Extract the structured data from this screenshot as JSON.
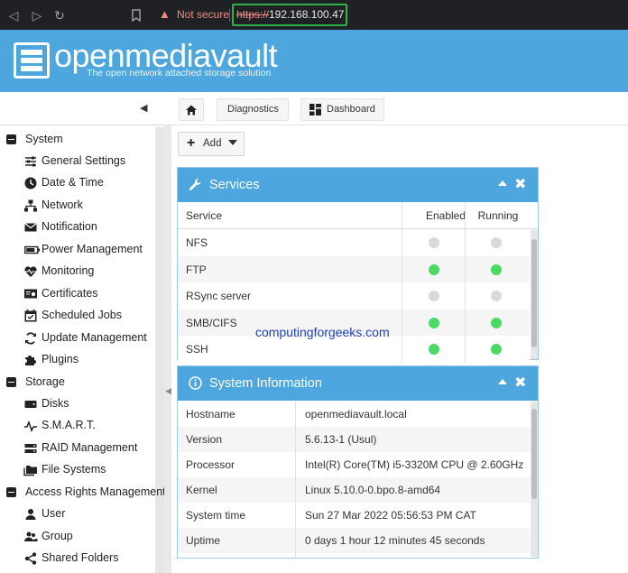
{
  "browser": {
    "back_icon": "back-arrow-icon",
    "forward_icon": "forward-arrow-icon",
    "reload_icon": "reload-icon",
    "bookmark_icon": "bookmark-icon",
    "security_label": "Not secure",
    "url_scheme": "https://",
    "url_host": "192.168.100.47"
  },
  "header": {
    "brand": "openmediavault",
    "tagline": "The open network attached storage solution"
  },
  "breadcrumb": {
    "home_icon": "home-icon",
    "items": [
      "Diagnostics",
      "Dashboard"
    ]
  },
  "toolbar": {
    "add_label": "Add"
  },
  "sidebar": {
    "groups": [
      {
        "label": "System",
        "items": [
          {
            "label": "General Settings",
            "icon": "sliders-icon"
          },
          {
            "label": "Date & Time",
            "icon": "clock-icon"
          },
          {
            "label": "Network",
            "icon": "network-icon"
          },
          {
            "label": "Notification",
            "icon": "envelope-icon"
          },
          {
            "label": "Power Management",
            "icon": "battery-icon"
          },
          {
            "label": "Monitoring",
            "icon": "heartbeat-icon"
          },
          {
            "label": "Certificates",
            "icon": "certificate-icon"
          },
          {
            "label": "Scheduled Jobs",
            "icon": "calendar-icon"
          },
          {
            "label": "Update Management",
            "icon": "sync-icon"
          },
          {
            "label": "Plugins",
            "icon": "puzzle-icon"
          }
        ]
      },
      {
        "label": "Storage",
        "items": [
          {
            "label": "Disks",
            "icon": "disk-icon"
          },
          {
            "label": "S.M.A.R.T.",
            "icon": "pulse-icon"
          },
          {
            "label": "RAID Management",
            "icon": "raid-icon"
          },
          {
            "label": "File Systems",
            "icon": "folders-icon"
          }
        ]
      },
      {
        "label": "Access Rights Management",
        "items": [
          {
            "label": "User",
            "icon": "user-icon"
          },
          {
            "label": "Group",
            "icon": "group-icon"
          },
          {
            "label": "Shared Folders",
            "icon": "share-icon"
          }
        ]
      }
    ]
  },
  "services_widget": {
    "title": "Services",
    "columns": [
      "Service",
      "Enabled",
      "Running"
    ],
    "rows": [
      {
        "name": "NFS",
        "enabled": false,
        "running": false
      },
      {
        "name": "FTP",
        "enabled": true,
        "running": true
      },
      {
        "name": "RSync server",
        "enabled": false,
        "running": false
      },
      {
        "name": "SMB/CIFS",
        "enabled": true,
        "running": true
      },
      {
        "name": "SSH",
        "enabled": true,
        "running": true
      }
    ],
    "color_on": "#4cd964",
    "color_off": "#d9d9d9"
  },
  "system_info_widget": {
    "title": "System Information",
    "rows": [
      {
        "key": "Hostname",
        "value": "openmediavault.local"
      },
      {
        "key": "Version",
        "value": "5.6.13-1 (Usul)"
      },
      {
        "key": "Processor",
        "value": "Intel(R) Core(TM) i5-3320M CPU @ 2.60GHz"
      },
      {
        "key": "Kernel",
        "value": "Linux 5.10.0-0.bpo.8-amd64"
      },
      {
        "key": "System time",
        "value": "Sun 27 Mar 2022 05:56:53 PM CAT"
      },
      {
        "key": "Uptime",
        "value": "0 days 1 hour 12 minutes 45 seconds"
      }
    ]
  },
  "watermark": "computingforgeeks.com",
  "colors": {
    "accent": "#4da6dd",
    "browser_bg": "#202124",
    "url_highlight": "#2fb04a"
  }
}
